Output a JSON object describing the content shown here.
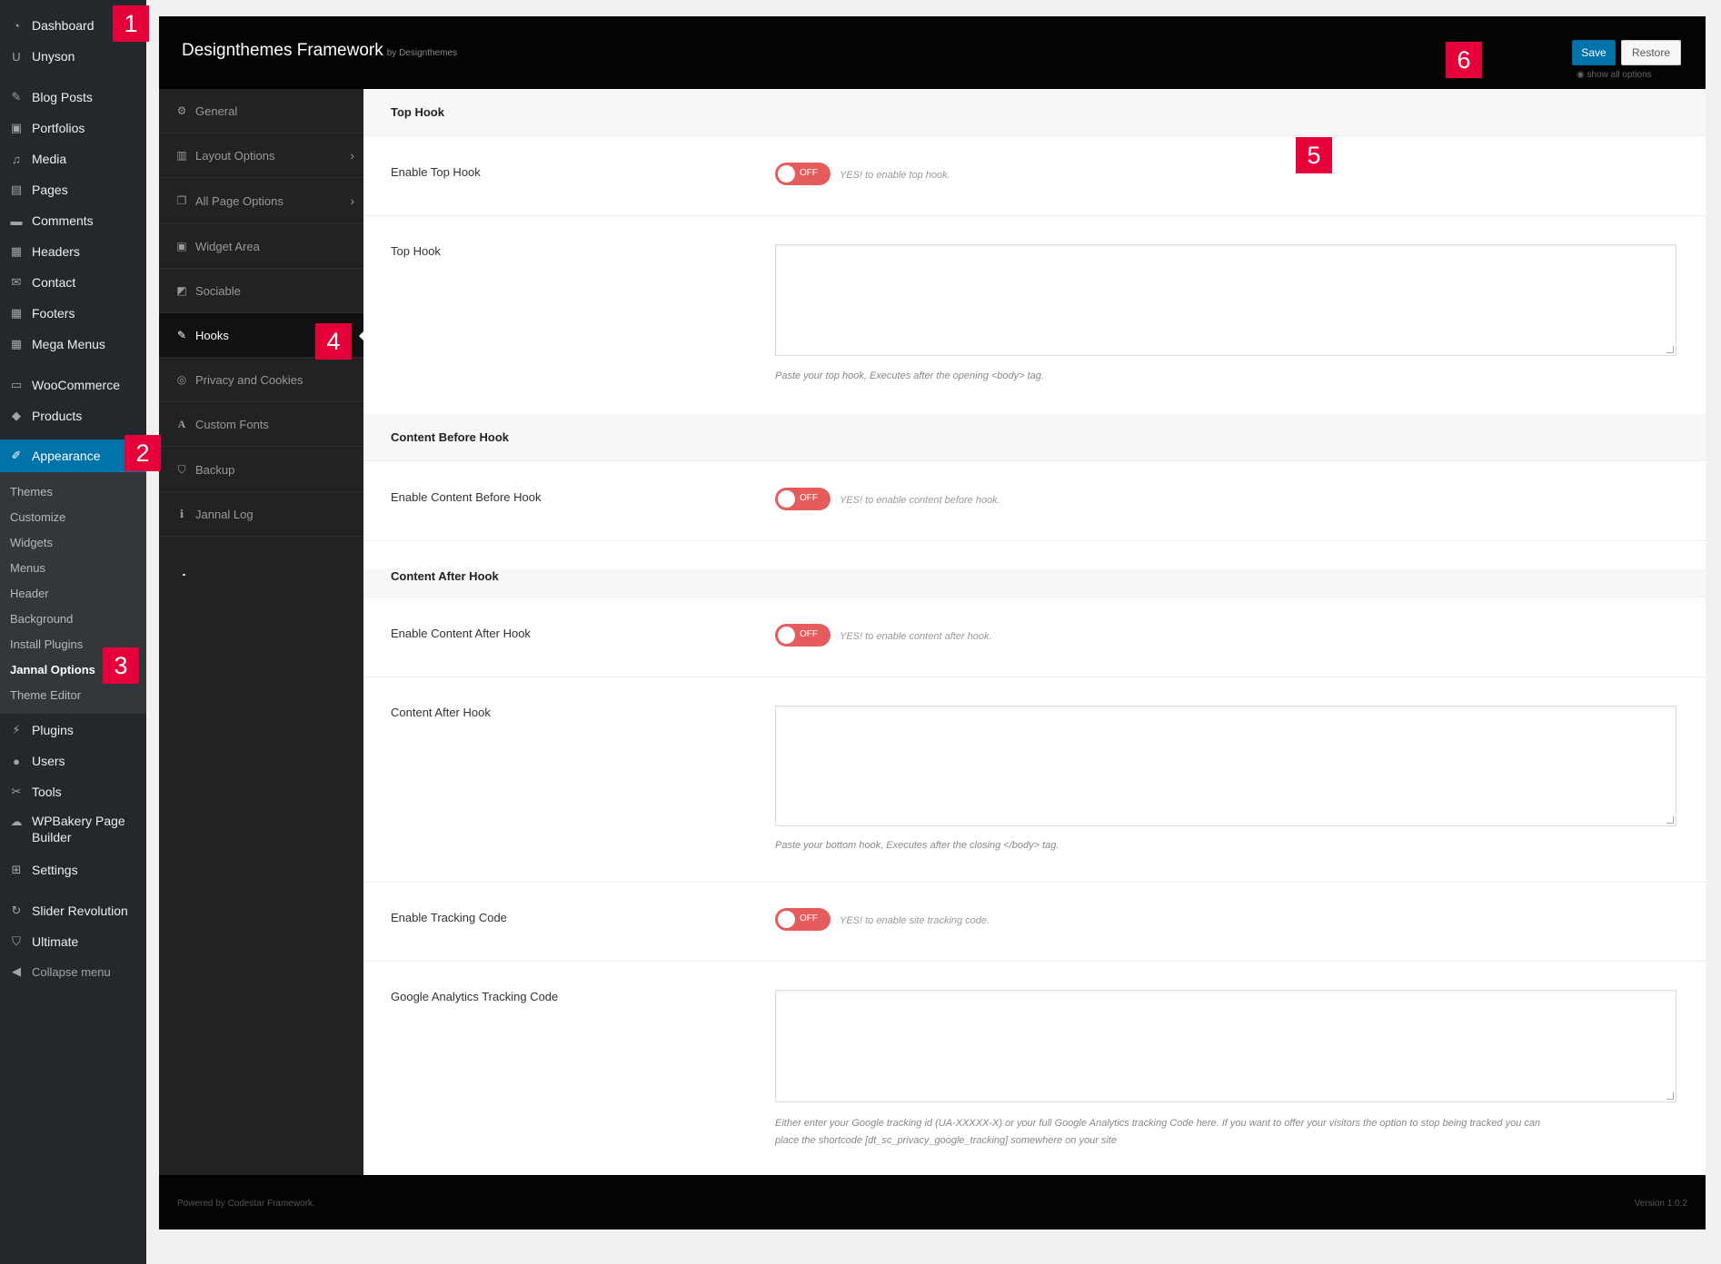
{
  "wp_menu": {
    "items": [
      {
        "label": "Dashboard",
        "icon": "dashboard-icon"
      },
      {
        "label": "Unyson",
        "icon": "unyson-icon"
      },
      {
        "label": "Blog Posts",
        "icon": "pin-icon"
      },
      {
        "label": "Portfolios",
        "icon": "portfolio-icon"
      },
      {
        "label": "Media",
        "icon": "media-icon"
      },
      {
        "label": "Pages",
        "icon": "pages-icon"
      },
      {
        "label": "Comments",
        "icon": "comments-icon"
      },
      {
        "label": "Headers",
        "icon": "grid-icon"
      },
      {
        "label": "Contact",
        "icon": "mail-icon"
      },
      {
        "label": "Footers",
        "icon": "grid-icon"
      },
      {
        "label": "Mega Menus",
        "icon": "grid-icon"
      },
      {
        "label": "WooCommerce",
        "icon": "woo-icon"
      },
      {
        "label": "Products",
        "icon": "box-icon"
      },
      {
        "label": "Appearance",
        "icon": "brush-icon"
      },
      {
        "label": "Plugins",
        "icon": "plug-icon"
      },
      {
        "label": "Users",
        "icon": "user-icon"
      },
      {
        "label": "Tools",
        "icon": "wrench-icon"
      },
      {
        "label": "WPBakery Page Builder",
        "label_line1": "WPBakery Page",
        "label_line2": "Builder",
        "icon": "cloud-icon"
      },
      {
        "label": "Settings",
        "icon": "settings-icon"
      },
      {
        "label": "Slider Revolution",
        "icon": "refresh-icon"
      },
      {
        "label": "Ultimate",
        "icon": "shield-icon"
      },
      {
        "label": "Collapse menu",
        "icon": "collapse-icon"
      }
    ],
    "submenu": [
      "Themes",
      "Customize",
      "Widgets",
      "Menus",
      "Header",
      "Background",
      "Install Plugins",
      "Jannal Options",
      "Theme Editor"
    ],
    "current_submenu": "Jannal Options"
  },
  "framework": {
    "title": "Designthemes Framework",
    "by": "by Designthemes",
    "save_label": "Save",
    "restore_label": "Restore",
    "show_all": "show all options",
    "footer_powered": "Powered by Codestar Framework.",
    "footer_version": "Version 1.0.2"
  },
  "fw_nav": [
    {
      "label": "General",
      "icon": "gears-icon"
    },
    {
      "label": "Layout Options",
      "icon": "layout-icon",
      "arrow": "›"
    },
    {
      "label": "All Page Options",
      "icon": "copy-icon",
      "arrow": "›"
    },
    {
      "label": "Widget Area",
      "icon": "widget-icon"
    },
    {
      "label": "Sociable",
      "icon": "share-icon"
    },
    {
      "label": "Hooks",
      "icon": "paperclip-icon"
    },
    {
      "label": "Privacy and Cookies",
      "icon": "eye-slash-icon"
    },
    {
      "label": "Custom Fonts",
      "icon": "font-icon"
    },
    {
      "label": "Backup",
      "icon": "shield-icon"
    },
    {
      "label": "Jannal Log",
      "icon": "info-icon"
    }
  ],
  "content": {
    "sections": [
      {
        "title": "Top Hook"
      },
      {
        "title": "Content Before Hook"
      },
      {
        "title": "Content After Hook"
      }
    ],
    "fields": {
      "enable_top_hook": {
        "label": "Enable Top Hook",
        "state": "OFF",
        "help": "YES! to enable top hook."
      },
      "top_hook": {
        "label": "Top Hook",
        "value": "",
        "desc": "Paste your top hook, Executes after the opening <body> tag."
      },
      "enable_content_before": {
        "label": "Enable Content Before Hook",
        "state": "OFF",
        "help": "YES! to enable content before hook."
      },
      "enable_content_after": {
        "label": "Enable Content After Hook",
        "state": "OFF",
        "help": "YES! to enable content after hook."
      },
      "content_after_hook": {
        "label": "Content After Hook",
        "value": "",
        "desc": "Paste your bottom hook, Executes after the closing </body> tag."
      },
      "enable_tracking": {
        "label": "Enable Tracking Code",
        "state": "OFF",
        "help": "YES! to enable site tracking code."
      },
      "ga_tracking": {
        "label": "Google Analytics Tracking Code",
        "value": "",
        "desc_line1": "Either enter your Google tracking id (UA-XXXXX-X) or your full Google Analytics tracking Code here. If you want to offer your visitors the option to stop being tracked you can",
        "desc_line2": "place the shortcode [dt_sc_privacy_google_tracking] somewhere on your site"
      }
    }
  },
  "badges": [
    "1",
    "2",
    "3",
    "4",
    "5",
    "6"
  ],
  "colors": {
    "wp_sidebar": "#23282d",
    "wp_active": "#0073aa",
    "toggle_off": "#e65c5c",
    "badge": "#e60039",
    "fw_header": "#040404"
  }
}
